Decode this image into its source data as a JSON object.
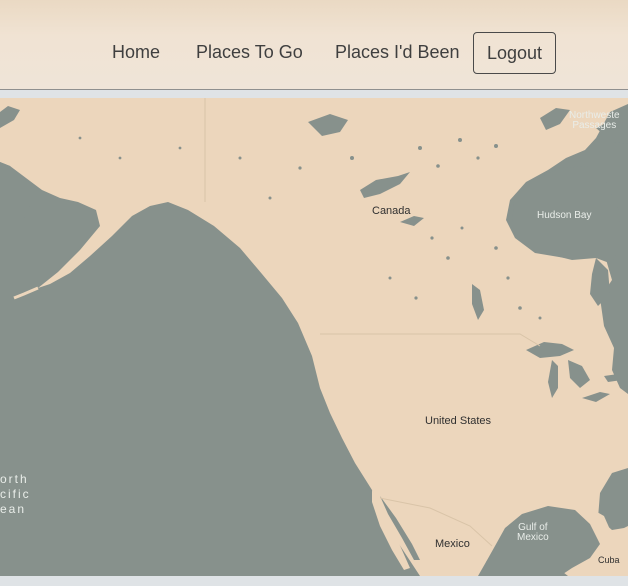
{
  "nav": {
    "home": "Home",
    "places_to_go": "Places To Go",
    "places_been": "Places I'd Been",
    "logout": "Logout"
  },
  "map": {
    "labels": {
      "canada": "Canada",
      "united_states": "United States",
      "mexico": "Mexico",
      "cuba": "Cuba",
      "hudson_bay": "Hudson Bay",
      "gulf_of_mexico_1": "Gulf of",
      "gulf_of_mexico_2": "Mexico",
      "northwest_1": "Northweste",
      "northwest_2": "Passages",
      "pacific_1": "orth",
      "pacific_2": "cific",
      "pacific_3": "ean"
    }
  },
  "colors": {
    "land": "#ecd6bc",
    "water": "#87918c",
    "nav_bg": "#efe3d4",
    "text": "#3f3f3f"
  }
}
